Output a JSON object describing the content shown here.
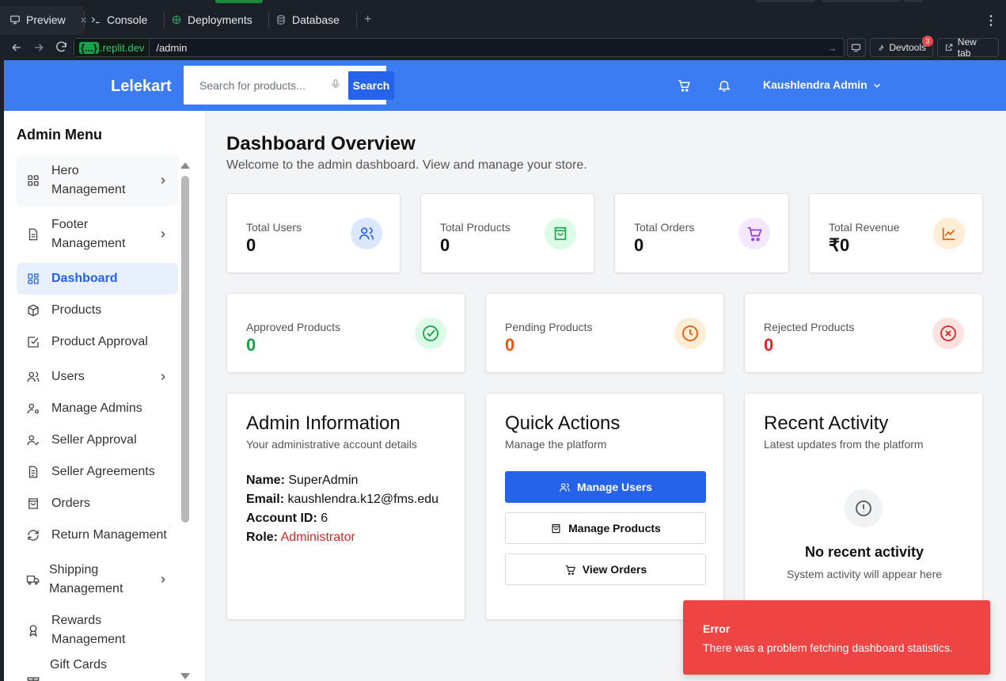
{
  "ide": {
    "tabs": [
      {
        "label": "Preview",
        "icon": "monitor-icon"
      },
      {
        "label": "Console",
        "icon": "terminal-icon"
      },
      {
        "label": "Deployments",
        "icon": "deploy-icon"
      },
      {
        "label": "Database",
        "icon": "database-icon"
      }
    ],
    "close_glyph": "×",
    "new_tab_glyph": "+",
    "url_host": ".replit.dev",
    "url_braces": "{...}",
    "url_path": "/admin",
    "devtools_label": "Devtools",
    "devtools_badge": "3",
    "new_tab_label": "New tab"
  },
  "header": {
    "brand": "Lelekart",
    "search_placeholder": "Search for products...",
    "search_button": "Search",
    "user_name": "Kaushlendra Admin"
  },
  "sidebar": {
    "title": "Admin Menu",
    "items": [
      {
        "label": "Hero Management",
        "line1": "Hero",
        "line2": "Management",
        "icon": "grid-icon",
        "has_submenu": true
      },
      {
        "label": "Footer Management",
        "line1": "Footer",
        "line2": "Management",
        "icon": "file-icon",
        "has_submenu": true
      },
      {
        "label": "Dashboard",
        "icon": "dashboard-icon",
        "active": true
      },
      {
        "label": "Products",
        "icon": "box-icon"
      },
      {
        "label": "Product Approval",
        "icon": "check-square-icon"
      },
      {
        "label": "Users",
        "icon": "users-icon",
        "has_submenu": true
      },
      {
        "label": "Manage Admins",
        "icon": "user-cog-icon"
      },
      {
        "label": "Seller Approval",
        "icon": "user-check-icon"
      },
      {
        "label": "Seller Agreements",
        "icon": "document-icon"
      },
      {
        "label": "Orders",
        "icon": "shopping-bag-icon"
      },
      {
        "label": "Return Management",
        "icon": "refresh-icon"
      },
      {
        "label": "Shipping Management",
        "line1": "Shipping",
        "line2": "Management",
        "icon": "truck-icon",
        "has_submenu": true
      },
      {
        "label": "Rewards Management",
        "line1": "Rewards",
        "line2": "Management",
        "icon": "award-icon"
      },
      {
        "label": "Gift Cards",
        "icon": "gift-icon"
      }
    ]
  },
  "main": {
    "title": "Dashboard Overview",
    "subtitle": "Welcome to the admin dashboard. View and manage your store.",
    "stats": [
      {
        "label": "Total Users",
        "value": "0",
        "icon": "users-icon",
        "color": "#2563eb",
        "bg": "#dbe7fd"
      },
      {
        "label": "Total Products",
        "value": "0",
        "icon": "shopping-bag-icon",
        "color": "#16a34a",
        "bg": "#dcfce7"
      },
      {
        "label": "Total Orders",
        "value": "0",
        "icon": "cart-icon",
        "color": "#9333ea",
        "bg": "#f3e8ff"
      },
      {
        "label": "Total Revenue",
        "value": "₹0",
        "icon": "line-chart-icon",
        "color": "#ea580c",
        "bg": "#ffedd5"
      }
    ],
    "product_stats": [
      {
        "label": "Approved Products",
        "value": "0",
        "value_color": "#16a34a",
        "icon": "check-circle-icon",
        "color": "#16a34a",
        "bg": "#dcfce7"
      },
      {
        "label": "Pending Products",
        "value": "0",
        "value_color": "#ea580c",
        "icon": "clock-icon",
        "color": "#ea580c",
        "bg": "#ffedd5"
      },
      {
        "label": "Rejected Products",
        "value": "0",
        "value_color": "#dc2626",
        "icon": "x-circle-icon",
        "color": "#dc2626",
        "bg": "#fee2e2"
      }
    ],
    "admin_info": {
      "title": "Admin Information",
      "subtitle": "Your administrative account details",
      "name_label": "Name:",
      "name": "SuperAdmin",
      "email_label": "Email:",
      "email": "kaushlendra.k12@fms.edu",
      "account_label": "Account ID:",
      "account_id": "6",
      "role_label": "Role:",
      "role": "Administrator"
    },
    "quick_actions": {
      "title": "Quick Actions",
      "subtitle": "Manage the platform",
      "buttons": [
        "Manage Users",
        "Manage Products",
        "View Orders"
      ]
    },
    "recent_activity": {
      "title": "Recent Activity",
      "subtitle": "Latest updates from the platform",
      "empty_title": "No recent activity",
      "empty_subtitle": "System activity will appear here"
    }
  },
  "toast": {
    "title": "Error",
    "message": "There was a problem fetching dashboard statistics."
  }
}
